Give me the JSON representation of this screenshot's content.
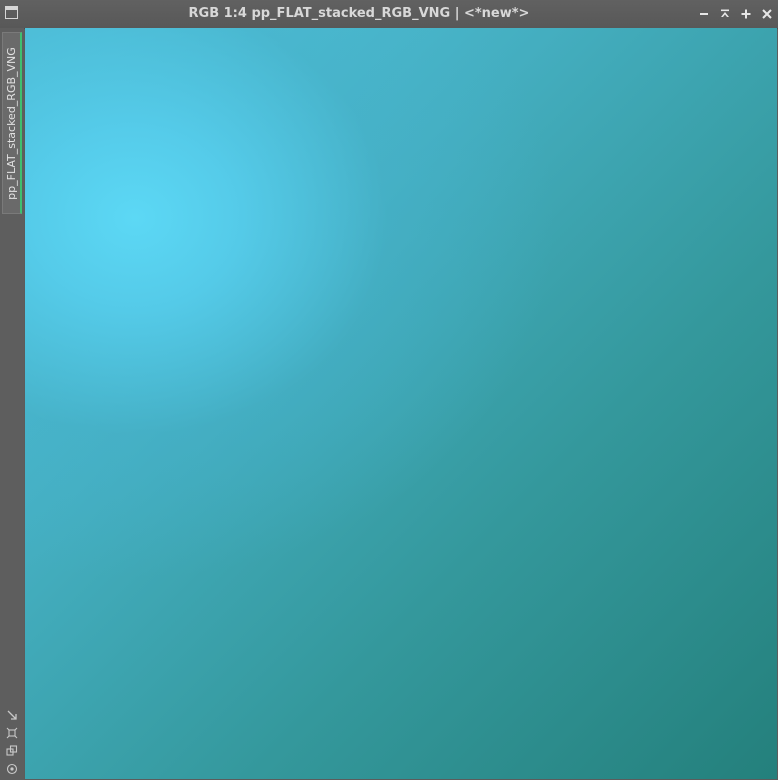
{
  "window": {
    "title": "RGB 1:4 pp_FLAT_stacked_RGB_VNG | <*new*>",
    "controls": [
      "minimize-icon",
      "shade-icon",
      "maximize-icon",
      "close-icon"
    ]
  },
  "sidebar": {
    "tab_label": "pp_FLAT_stacked_RGB_VNG",
    "accent_color": "#3fbf6f",
    "tools": [
      "zoom-to-fit-icon",
      "fit-view-icon",
      "clone-icon",
      "options-icon"
    ]
  },
  "image": {
    "colors": [
      "#5cd8f5",
      "#44aec0",
      "#24807c"
    ]
  }
}
